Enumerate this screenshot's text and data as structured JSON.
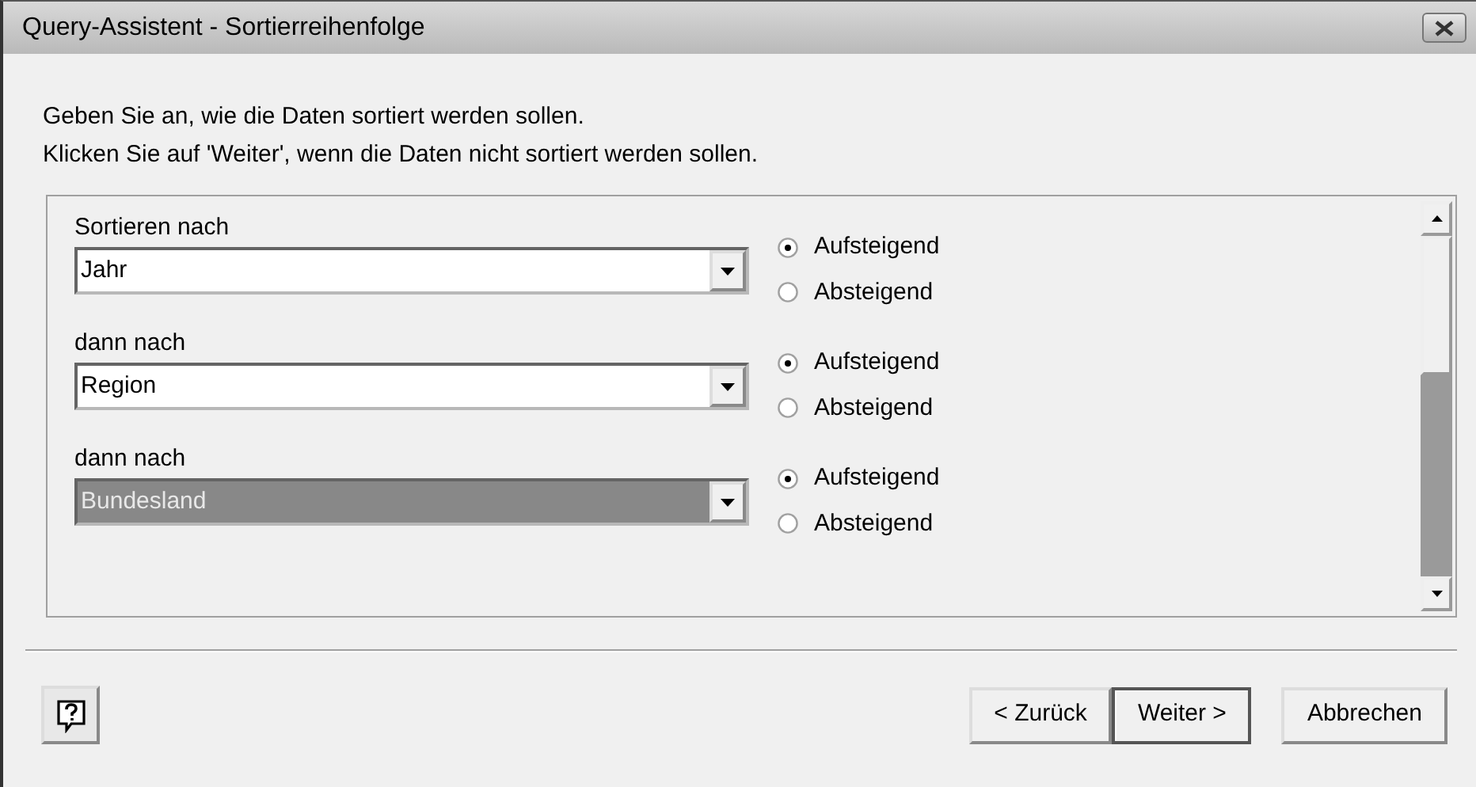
{
  "window": {
    "title": "Query-Assistent - Sortierreihenfolge"
  },
  "instructions": [
    "Geben Sie an, wie die Daten sortiert werden sollen.",
    "Klicken Sie auf 'Weiter', wenn die Daten nicht sortiert werden sollen."
  ],
  "sort_rows": [
    {
      "label": "Sortieren nach",
      "field": {
        "value": "Jahr",
        "selected": false
      },
      "options": [
        {
          "label": "Aufsteigend",
          "selected": true
        },
        {
          "label": "Absteigend",
          "selected": false
        }
      ]
    },
    {
      "label": "dann nach",
      "field": {
        "value": "Region",
        "selected": false
      },
      "options": [
        {
          "label": "Aufsteigend",
          "selected": true
        },
        {
          "label": "Absteigend",
          "selected": false
        }
      ]
    },
    {
      "label": "dann nach",
      "field": {
        "value": "Bundesland",
        "selected": true
      },
      "options": [
        {
          "label": "Aufsteigend",
          "selected": true
        },
        {
          "label": "Absteigend",
          "selected": false
        }
      ]
    }
  ],
  "buttons": [
    {
      "label": "< Zurück",
      "default": false
    },
    {
      "label": "Weiter >",
      "default": true
    },
    {
      "label": "Abbrechen",
      "default": false
    }
  ]
}
